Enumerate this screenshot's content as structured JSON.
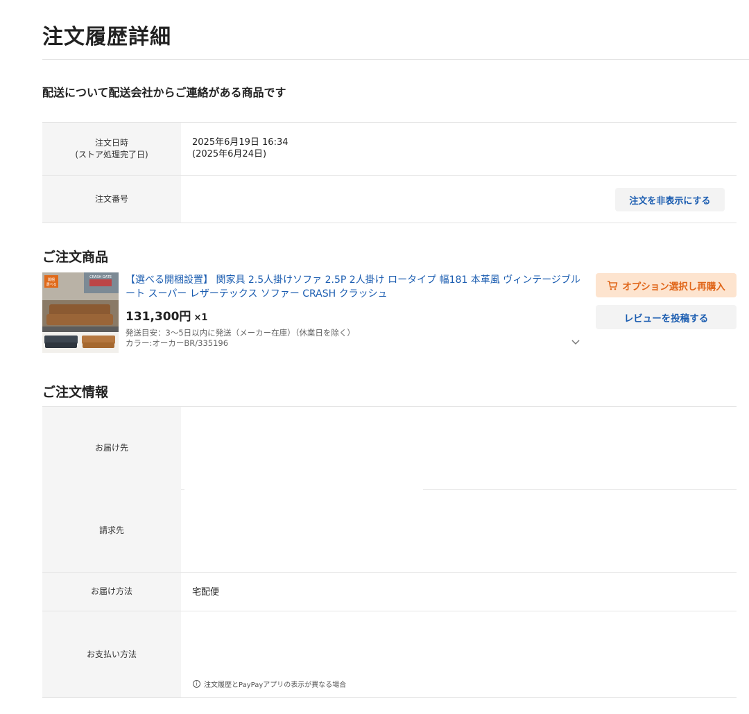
{
  "page": {
    "title": "注文履歴詳細"
  },
  "notice": "配送について配送会社からご連絡がある商品です",
  "order_info": {
    "date_label_line1": "注文日時",
    "date_label_line2": "(ストア処理完了日)",
    "date_value_line1": "2025年6月19日 16:34",
    "date_value_line2": "(2025年6月24日)",
    "number_label": "注文番号",
    "number_value": "",
    "hide_button": "注文を非表示にする"
  },
  "products_section": {
    "heading": "ご注文商品",
    "item": {
      "name": "【選べる開梱設置】 関家具 2.5人掛けソファ 2.5P 2人掛け ロータイプ 幅181 本革風 ヴィンテージブルート スーパー レザーテックス ソファー CRASH クラッシュ",
      "price": "131,300円",
      "quantity": "×1",
      "shipping": "発送目安：3〜5日以内に発送（メーカー在庫）（休業日を除く）",
      "color": "カラー:オーカーBR/335196",
      "rebuy_button": "オプション選択し再購入",
      "review_button": "レビューを投稿する",
      "thumb_labels": {
        "badge": "開梱選べる",
        "brand": "CRASH GATE"
      }
    }
  },
  "order_details": {
    "heading": "ご注文情報",
    "rows": [
      {
        "label": "お届け先",
        "value": ""
      },
      {
        "label": "請求先",
        "value": ""
      },
      {
        "label": "お届け方法",
        "value": "宅配便"
      },
      {
        "label": "お支払い方法",
        "value": ""
      }
    ],
    "note": "注文履歴とPayPayアプリの表示が異なる場合"
  },
  "colors": {
    "link": "#1a5cb0",
    "rebuy_bg": "#fde4cf",
    "rebuy_text": "#e0661a",
    "label_bg": "#f5f5f5"
  },
  "icons": {
    "cart": "cart-icon",
    "chevron": "chevron-down-icon",
    "info": "info-icon"
  }
}
